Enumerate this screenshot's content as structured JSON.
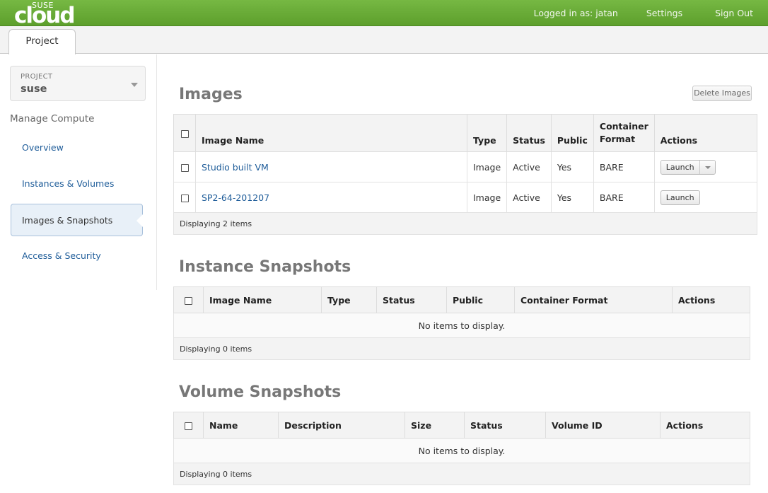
{
  "brand": {
    "top": "SUSE",
    "bottom": "cloud"
  },
  "header": {
    "user": "Logged in as: jatan",
    "settings": "Settings",
    "signout": "Sign Out"
  },
  "tabs": {
    "project": "Project"
  },
  "sidebar": {
    "switcher_label": "PROJECT",
    "switcher_value": "suse",
    "heading": "Manage Compute",
    "items": [
      "Overview",
      "Instances & Volumes",
      "Images & Snapshots",
      "Access & Security"
    ]
  },
  "images": {
    "title": "Images",
    "delete_button": "Delete Images",
    "columns": [
      "Image Name",
      "Type",
      "Status",
      "Public",
      "Container\nFormat",
      "Actions"
    ],
    "rows": [
      {
        "name": "Studio built VM",
        "type": "Image",
        "status": "Active",
        "public": "Yes",
        "format": "BARE",
        "action": "Launch"
      },
      {
        "name": "SP2-64-201207",
        "type": "Image",
        "status": "Active",
        "public": "Yes",
        "format": "BARE",
        "action": "Launch"
      }
    ],
    "footer": "Displaying 2 items"
  },
  "instance_snapshots": {
    "title": "Instance Snapshots",
    "columns": [
      "Image Name",
      "Type",
      "Status",
      "Public",
      "Container Format",
      "Actions"
    ],
    "empty": "No items to display.",
    "footer": "Displaying 0 items"
  },
  "volume_snapshots": {
    "title": "Volume Snapshots",
    "columns": [
      "Name",
      "Description",
      "Size",
      "Status",
      "Volume ID",
      "Actions"
    ],
    "empty": "No items to display.",
    "footer": "Displaying 0 items"
  },
  "colors": {
    "header_green": "#6aae37",
    "link": "#1e5c99"
  }
}
